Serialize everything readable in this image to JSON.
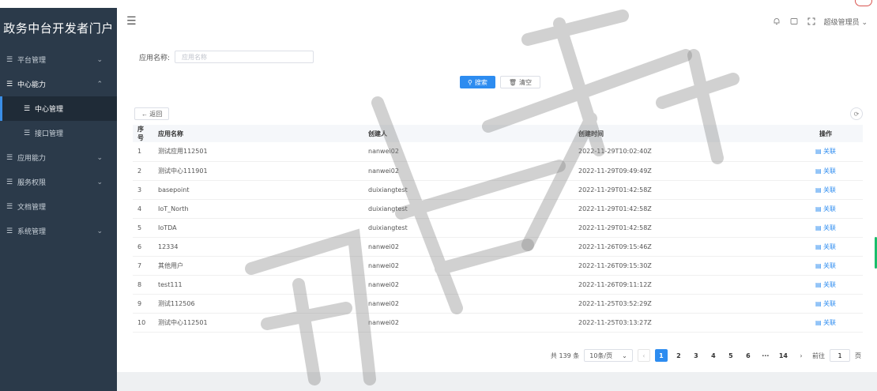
{
  "app": {
    "title": "政务中台开发者门户"
  },
  "sidebar": {
    "items": [
      {
        "label": "平台管理",
        "expanded": false
      },
      {
        "label": "中心能力",
        "expanded": true
      },
      {
        "label": "中心管理",
        "sub": true,
        "active": true
      },
      {
        "label": "接口管理",
        "sub": true,
        "active": false
      },
      {
        "label": "应用能力",
        "expanded": false
      },
      {
        "label": "服务权限",
        "expanded": false
      },
      {
        "label": "文档管理",
        "expanded": false
      },
      {
        "label": "系统管理",
        "expanded": false
      }
    ]
  },
  "header": {
    "user": "超级管理员"
  },
  "search": {
    "label": "应用名称:",
    "placeholder": "应用名称",
    "search_button": "搜索",
    "clear_button": "清空"
  },
  "toolbar": {
    "back_label": "← 返回"
  },
  "table": {
    "columns": [
      "序号",
      "应用名称",
      "创建人",
      "创建时间",
      "操作"
    ],
    "rows": [
      {
        "idx": "1",
        "name": "测试应用112501",
        "creator": "nanwei02",
        "time": "2022-11-29T10:02:40Z",
        "op": "关联"
      },
      {
        "idx": "2",
        "name": "测试中心111901",
        "creator": "nanwei02",
        "time": "2022-11-29T09:49:49Z",
        "op": "关联"
      },
      {
        "idx": "3",
        "name": "basepoint",
        "creator": "duixiangtest",
        "time": "2022-11-29T01:42:58Z",
        "op": "关联"
      },
      {
        "idx": "4",
        "name": "IoT_North",
        "creator": "duixiangtest",
        "time": "2022-11-29T01:42:58Z",
        "op": "关联"
      },
      {
        "idx": "5",
        "name": "IoTDA",
        "creator": "duixiangtest",
        "time": "2022-11-29T01:42:58Z",
        "op": "关联"
      },
      {
        "idx": "6",
        "name": "12334",
        "creator": "nanwei02",
        "time": "2022-11-26T09:15:46Z",
        "op": "关联"
      },
      {
        "idx": "7",
        "name": "其他用户",
        "creator": "nanwei02",
        "time": "2022-11-26T09:15:30Z",
        "op": "关联"
      },
      {
        "idx": "8",
        "name": "test111",
        "creator": "nanwei02",
        "time": "2022-11-26T09:11:12Z",
        "op": "关联"
      },
      {
        "idx": "9",
        "name": "测试112506",
        "creator": "nanwei02",
        "time": "2022-11-25T03:52:29Z",
        "op": "关联"
      },
      {
        "idx": "10",
        "name": "测试中心112501",
        "creator": "nanwei02",
        "time": "2022-11-25T03:13:27Z",
        "op": "关联"
      }
    ]
  },
  "pagination": {
    "total": "共 139 条",
    "page_size": "10条/页",
    "pages": [
      "1",
      "2",
      "3",
      "4",
      "5",
      "6",
      "···",
      "14"
    ],
    "current": "1",
    "jump_label": "前往",
    "jump_value": "1",
    "page_suffix": "页"
  },
  "colors": {
    "sidebar_bg": "#2b3a4a",
    "primary": "#2d8cf0",
    "active_item_bg": "#1f2b37"
  },
  "icons": {
    "menu": "hamburger-icon",
    "bell": "bell-icon",
    "message": "message-icon",
    "fullscreen": "fullscreen-icon"
  }
}
